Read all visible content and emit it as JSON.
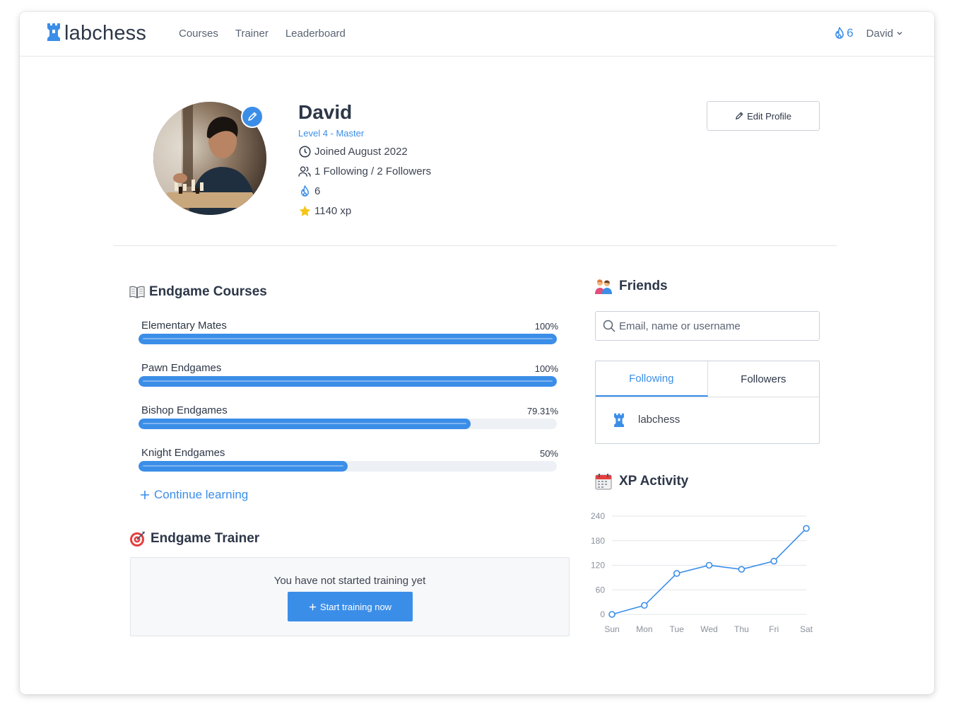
{
  "nav": {
    "brand": "labchess",
    "links": [
      "Courses",
      "Trainer",
      "Leaderboard"
    ],
    "streak": "6",
    "user": "David"
  },
  "profile": {
    "name": "David",
    "level": "Level 4 - Master",
    "joined": "Joined August 2022",
    "social": "1 Following / 2 Followers",
    "streak": "6",
    "xp": "1140 xp",
    "edit_label": "Edit Profile"
  },
  "courses": {
    "title": "Endgame Courses",
    "items": [
      {
        "name": "Elementary Mates",
        "pct_label": "100%",
        "progress": 100
      },
      {
        "name": "Pawn Endgames",
        "pct_label": "100%",
        "progress": 100
      },
      {
        "name": "Bishop Endgames",
        "pct_label": "79.31%",
        "progress": 79.31
      },
      {
        "name": "Knight Endgames",
        "pct_label": "50%",
        "progress": 50
      }
    ],
    "continue_label": "Continue learning"
  },
  "trainer": {
    "title": "Endgame Trainer",
    "message": "You have not started training yet",
    "button": "Start training now"
  },
  "friends": {
    "title": "Friends",
    "search_placeholder": "Email, name or username",
    "tabs": [
      "Following",
      "Followers"
    ],
    "active_tab": "Following",
    "list": [
      "labchess"
    ]
  },
  "xp_activity": {
    "title": "XP Activity"
  },
  "chart_data": {
    "type": "line",
    "categories": [
      "Sun",
      "Mon",
      "Tue",
      "Wed",
      "Thu",
      "Fri",
      "Sat"
    ],
    "values": [
      0,
      22,
      100,
      120,
      110,
      130,
      210
    ],
    "yticks": [
      0,
      60,
      120,
      180,
      240
    ],
    "ylim": [
      0,
      240
    ],
    "grid": true,
    "color": "#3b8ee8"
  },
  "colors": {
    "accent": "#3b8ee8",
    "text": "#2d3748"
  }
}
